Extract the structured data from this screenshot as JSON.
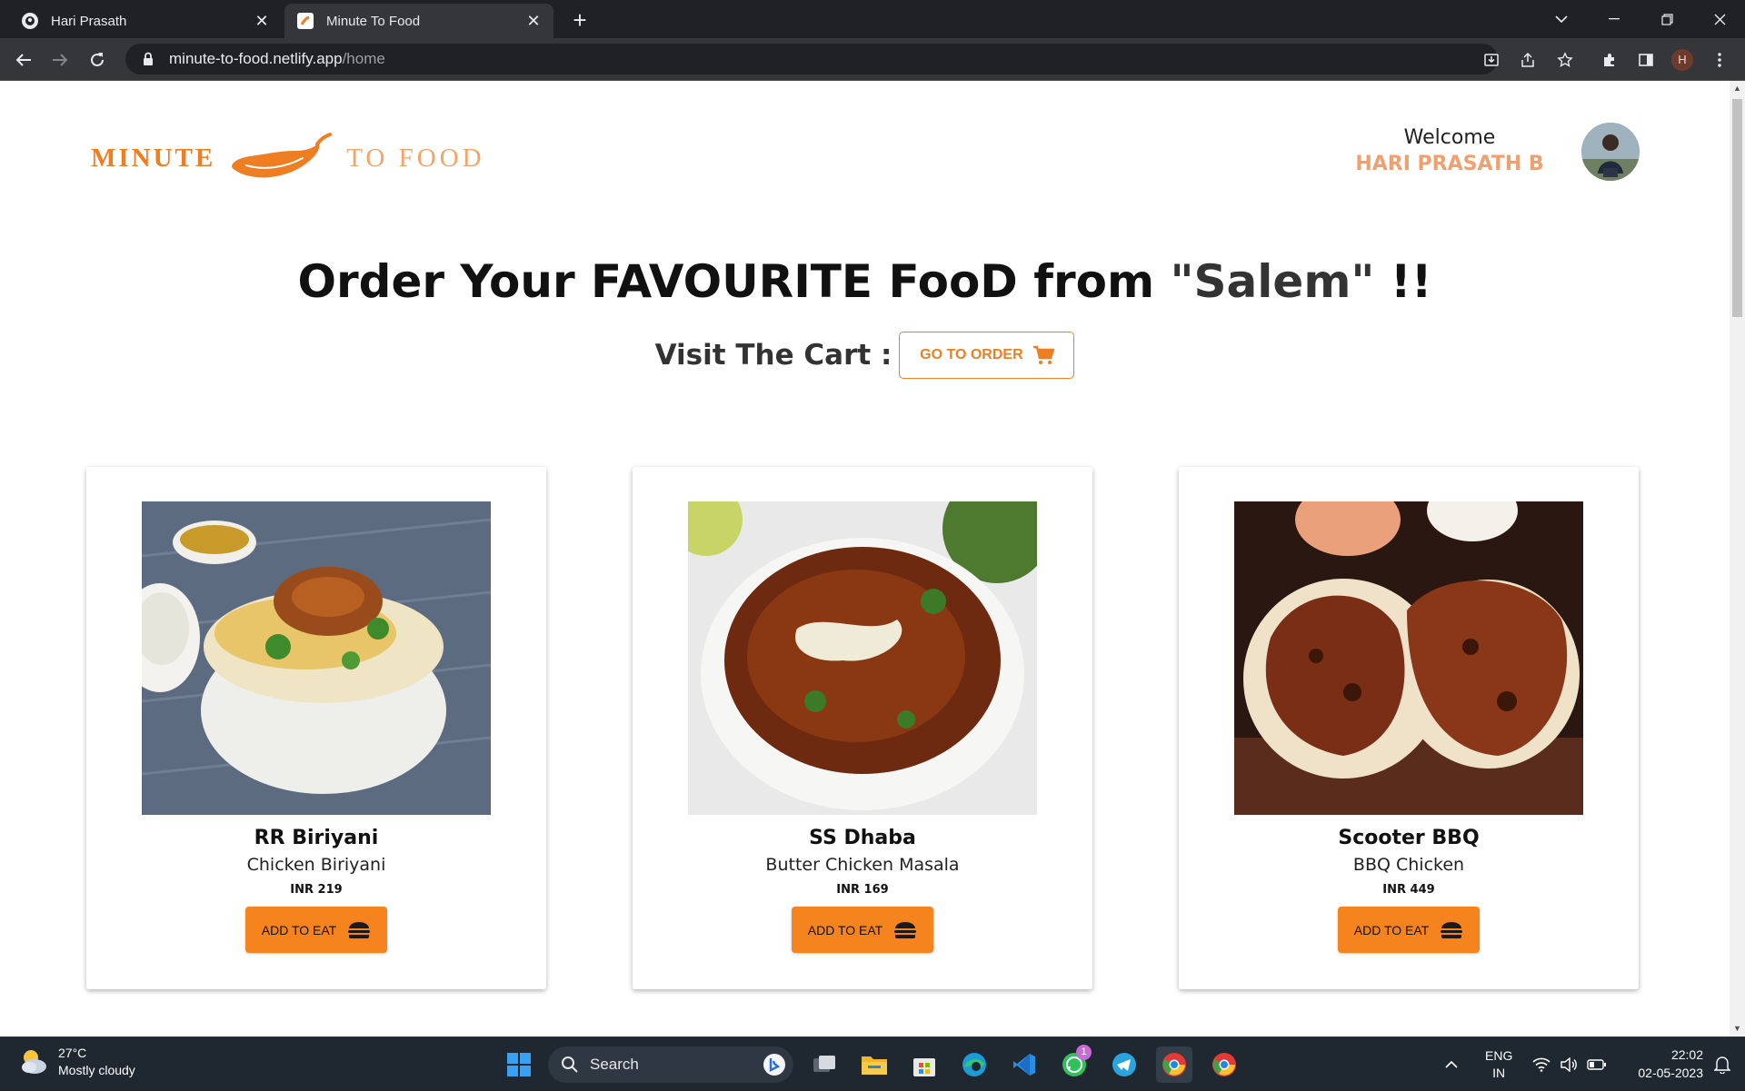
{
  "browser": {
    "tabs": [
      {
        "title": "Hari Prasath",
        "active": false
      },
      {
        "title": "Minute To Food",
        "active": true
      }
    ],
    "url_host": "minute-to-food.netlify.app",
    "url_path": "/home",
    "profile_initial": "H"
  },
  "page": {
    "logo_left": "MINUTE",
    "logo_right": "TO FOOD",
    "welcome_label": "Welcome",
    "user_name": "HARI PRASATH B",
    "headline_main": "Order Your FAVOURITE FooD from ",
    "headline_city": "\"Salem\"",
    "headline_end": " !!",
    "cart_label": "Visit The Cart :",
    "order_button": "GO TO ORDER",
    "accent_color": "#ef7d22",
    "items": [
      {
        "restaurant": "RR Biriyani",
        "dish": "Chicken Biriyani",
        "price": "INR 219",
        "button": "ADD TO EAT"
      },
      {
        "restaurant": "SS Dhaba",
        "dish": "Butter Chicken Masala",
        "price": "INR 169",
        "button": "ADD TO EAT"
      },
      {
        "restaurant": "Scooter BBQ",
        "dish": "BBQ Chicken",
        "price": "INR 449",
        "button": "ADD TO EAT"
      }
    ]
  },
  "taskbar": {
    "temperature": "27°C",
    "weather": "Mostly cloudy",
    "search_placeholder": "Search",
    "whatsapp_badge": "1",
    "lang_top": "ENG",
    "lang_bottom": "IN",
    "time": "22:02",
    "date": "02-05-2023"
  }
}
